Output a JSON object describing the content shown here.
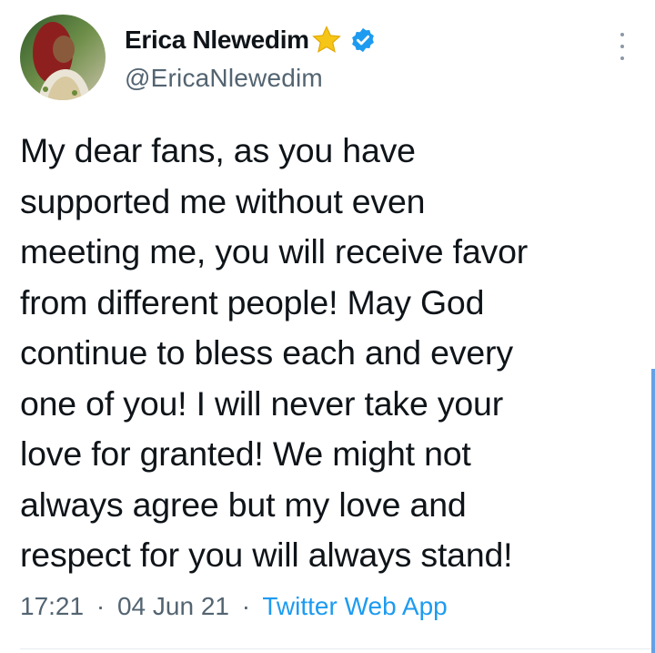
{
  "tweet": {
    "author": {
      "display_name": "Erica Nlewedim",
      "handle": "@EricaNlewedim",
      "verified": true,
      "name_emoji": "star"
    },
    "text": "My dear fans, as you have\nsupported me without even\nmeeting me, you will receive favor\nfrom different people! May God\ncontinue to bless each and every\none of you! I will never take your\nlove for granted! We might not\nalways agree but my love and\nrespect for you will always stand!",
    "time": "17:21",
    "date": "04 Jun 21",
    "separator": "·",
    "source": "Twitter Web App"
  },
  "colors": {
    "text": "#0f1419",
    "muted": "#536471",
    "link": "#1d9bf0",
    "verified": "#1d9bf0",
    "star": "#f5c518"
  },
  "icons": {
    "menu": "more-vertical-icon",
    "verified": "verified-badge-icon",
    "star": "star-icon"
  }
}
